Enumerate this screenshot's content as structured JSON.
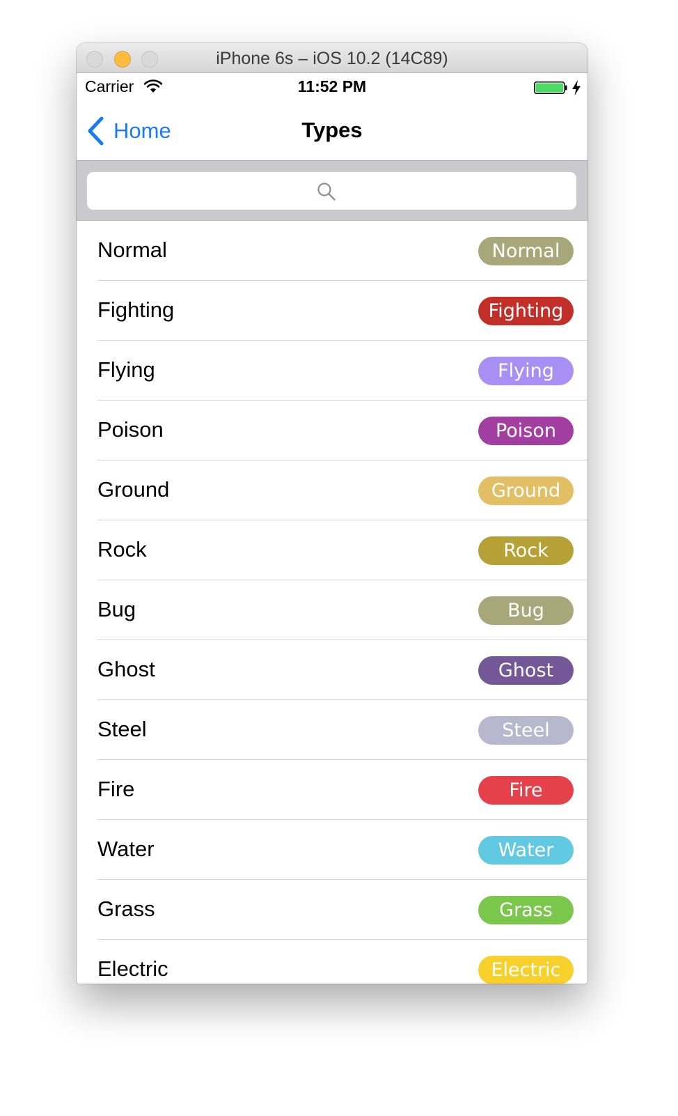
{
  "window": {
    "title": "iPhone 6s – iOS 10.2 (14C89)"
  },
  "statusbar": {
    "carrier": "Carrier",
    "time": "11:52 PM",
    "battery_color": "#4cd964"
  },
  "navbar": {
    "back_label": "Home",
    "title": "Types",
    "accent_color": "#1a7cf5"
  },
  "search": {
    "placeholder": "",
    "value": ""
  },
  "types": [
    {
      "name": "Normal",
      "badge": "Normal",
      "color": "#a8a77a"
    },
    {
      "name": "Fighting",
      "badge": "Fighting",
      "color": "#c22e28"
    },
    {
      "name": "Flying",
      "badge": "Flying",
      "color": "#a98ff3"
    },
    {
      "name": "Poison",
      "badge": "Poison",
      "color": "#a33ea1"
    },
    {
      "name": "Ground",
      "badge": "Ground",
      "color": "#e2bf65"
    },
    {
      "name": "Rock",
      "badge": "Rock",
      "color": "#b6a136"
    },
    {
      "name": "Bug",
      "badge": "Bug",
      "color": "#a8a77a"
    },
    {
      "name": "Ghost",
      "badge": "Ghost",
      "color": "#735797"
    },
    {
      "name": "Steel",
      "badge": "Steel",
      "color": "#b7b7ce"
    },
    {
      "name": "Fire",
      "badge": "Fire",
      "color": "#e4414a"
    },
    {
      "name": "Water",
      "badge": "Water",
      "color": "#62c9e3"
    },
    {
      "name": "Grass",
      "badge": "Grass",
      "color": "#7ac74c"
    },
    {
      "name": "Electric",
      "badge": "Electric",
      "color": "#f7d02c"
    }
  ]
}
